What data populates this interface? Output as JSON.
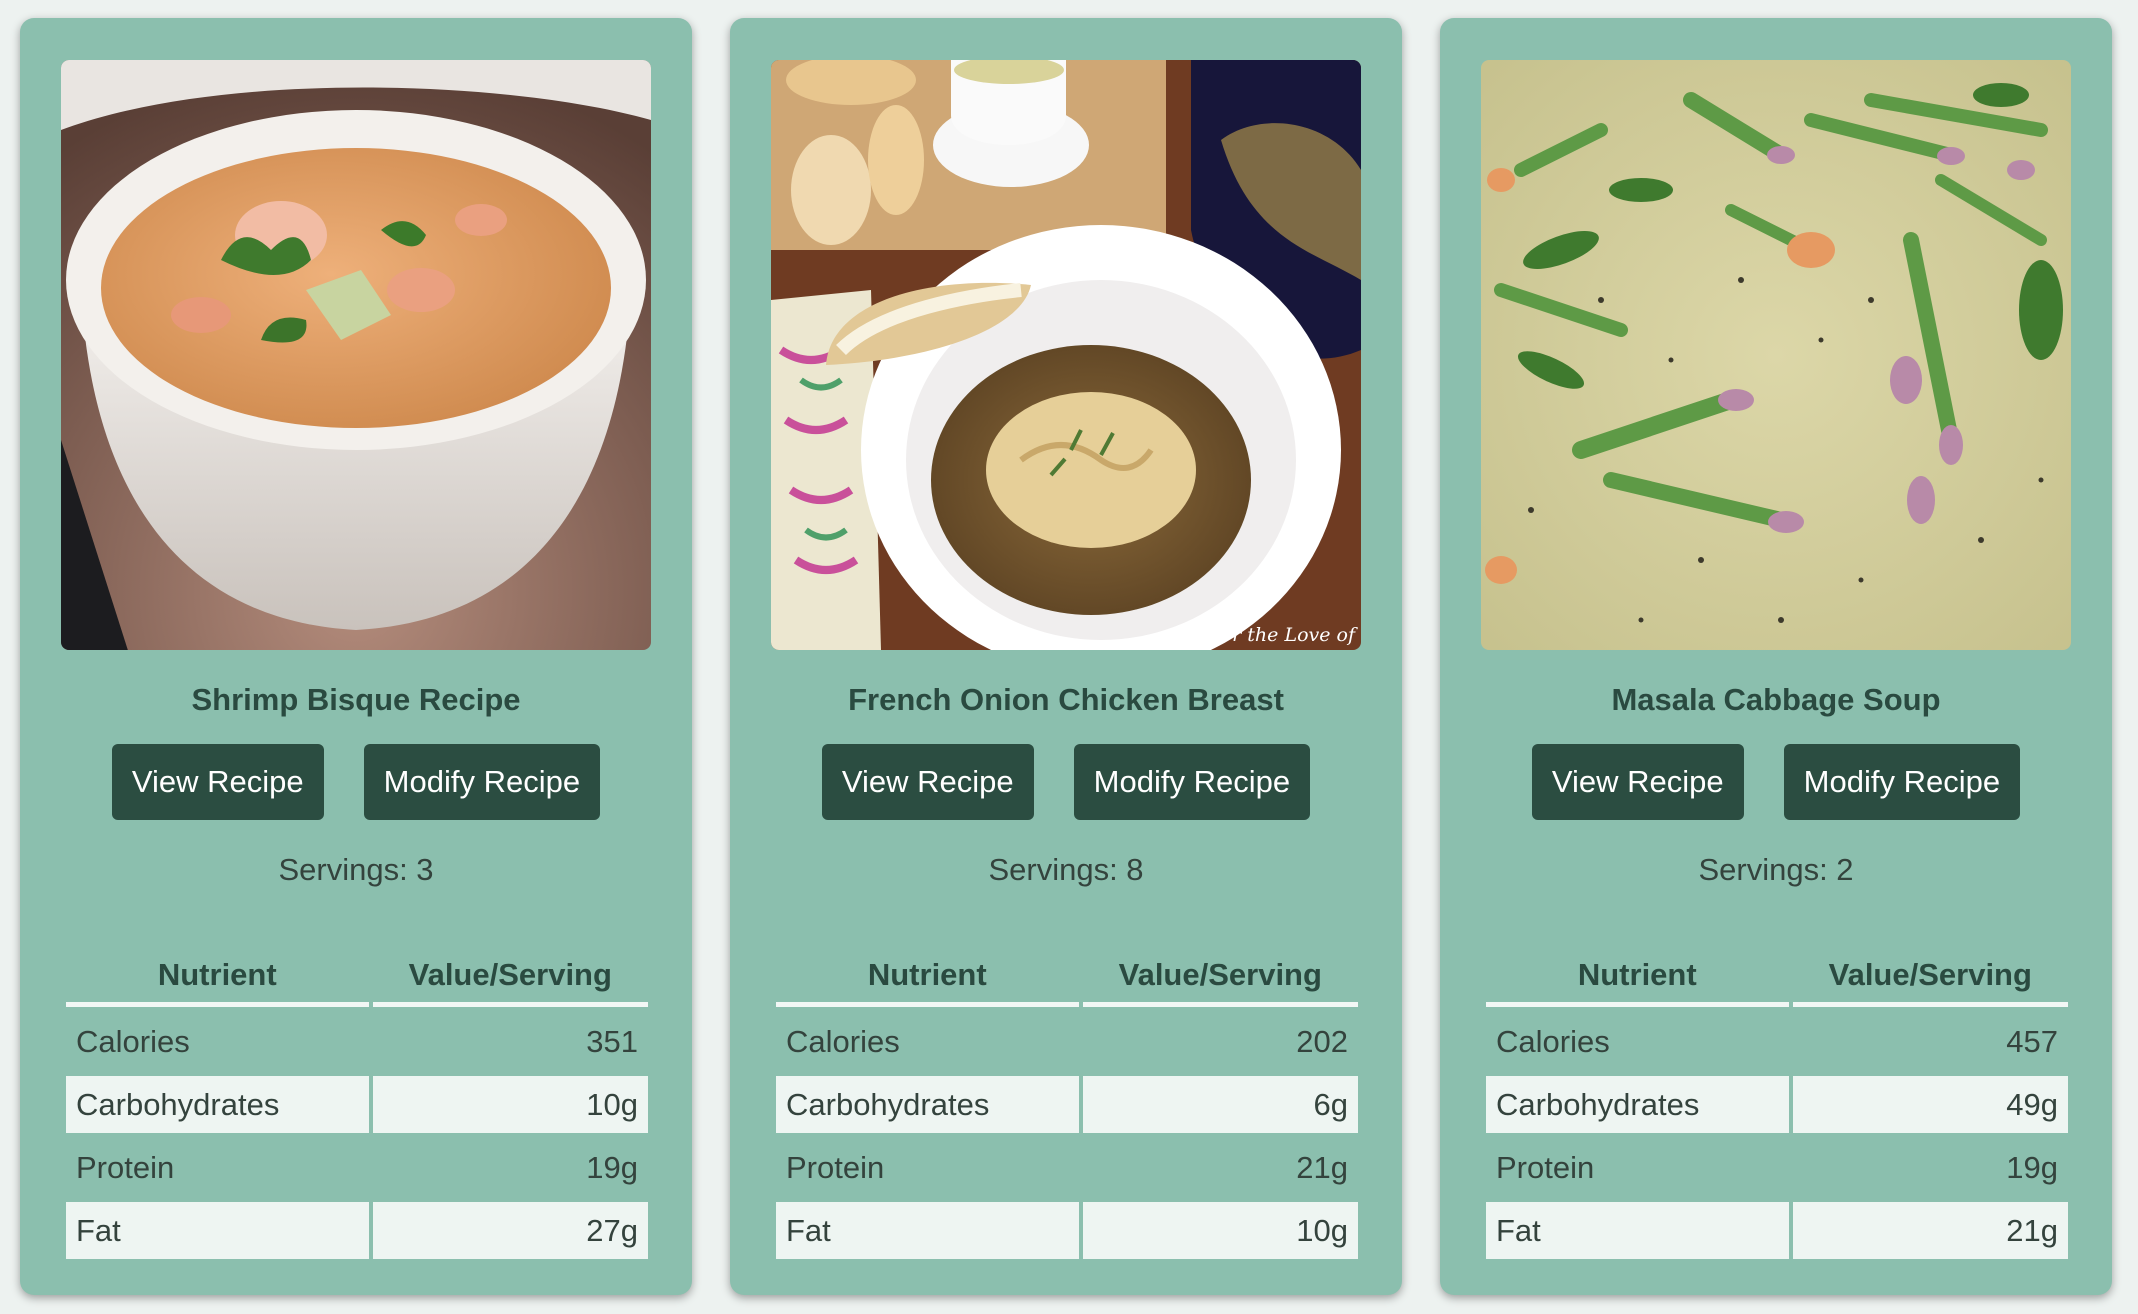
{
  "cards": [
    {
      "title": "Shrimp Bisque Recipe",
      "view_label": "View Recipe",
      "modify_label": "Modify Recipe",
      "servings": "Servings: 3",
      "photo_icon": "shrimp-bisque-bowl",
      "table": {
        "headers": [
          "Nutrient",
          "Value/Serving"
        ],
        "rows": [
          {
            "nutrient": "Calories",
            "value": "351"
          },
          {
            "nutrient": "Carbohydrates",
            "value": "10g"
          },
          {
            "nutrient": "Protein",
            "value": "19g"
          },
          {
            "nutrient": "Fat",
            "value": "27g"
          }
        ]
      }
    },
    {
      "title": "French Onion Chicken Breast",
      "view_label": "View Recipe",
      "modify_label": "Modify Recipe",
      "servings": "Servings: 8",
      "photo_icon": "chicken-plate",
      "photo_caption": "For the Love of",
      "table": {
        "headers": [
          "Nutrient",
          "Value/Serving"
        ],
        "rows": [
          {
            "nutrient": "Calories",
            "value": "202"
          },
          {
            "nutrient": "Carbohydrates",
            "value": "6g"
          },
          {
            "nutrient": "Protein",
            "value": "21g"
          },
          {
            "nutrient": "Fat",
            "value": "10g"
          }
        ]
      }
    },
    {
      "title": "Masala Cabbage Soup",
      "view_label": "View Recipe",
      "modify_label": "Modify Recipe",
      "servings": "Servings: 2",
      "photo_icon": "asparagus-soup",
      "table": {
        "headers": [
          "Nutrient",
          "Value/Serving"
        ],
        "rows": [
          {
            "nutrient": "Calories",
            "value": "457"
          },
          {
            "nutrient": "Carbohydrates",
            "value": "49g"
          },
          {
            "nutrient": "Protein",
            "value": "19g"
          },
          {
            "nutrient": "Fat",
            "value": "21g"
          }
        ]
      }
    }
  ],
  "colors": {
    "page_bg": "#edf2f0",
    "card_bg": "#8bbfae",
    "button_bg": "#2b4d41",
    "title_text": "#2a4a40",
    "row_alt_bg": "#eef5f2"
  }
}
